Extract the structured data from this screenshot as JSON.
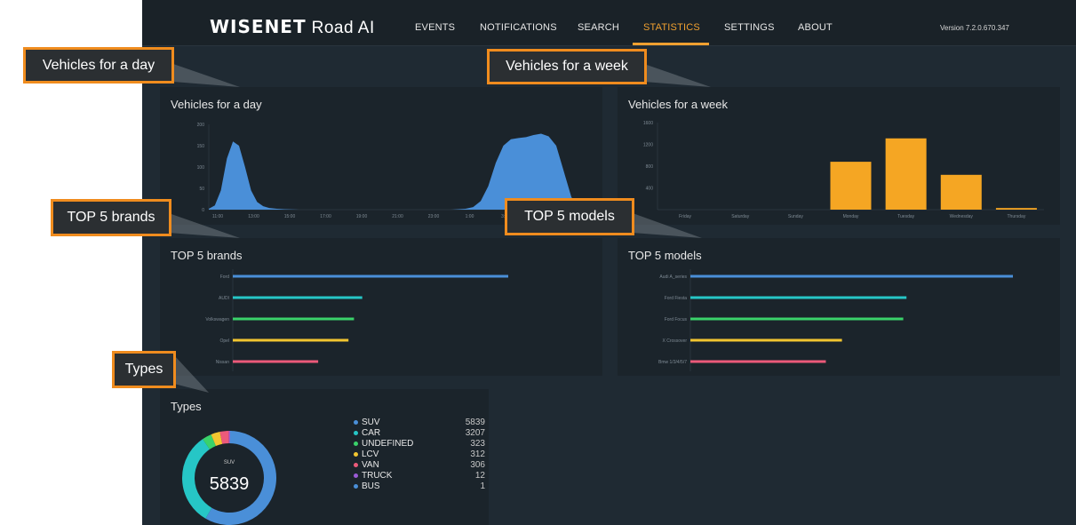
{
  "header": {
    "logo_brand": "WISENET",
    "logo_product": "Road AI",
    "nav": [
      {
        "label": "EVENTS",
        "active": false
      },
      {
        "label": "NOTIFICATIONS",
        "active": false
      },
      {
        "label": "SEARCH",
        "active": false
      },
      {
        "label": "STATISTICS",
        "active": true
      },
      {
        "label": "SETTINGS",
        "active": false
      },
      {
        "label": "ABOUT",
        "active": false
      }
    ],
    "version": "Version 7.2.0.670.347"
  },
  "callouts": {
    "day": "Vehicles for a day",
    "week": "Vehicles for a week",
    "brands": "TOP 5 brands",
    "models": "TOP 5 models",
    "types": "Types"
  },
  "colors": {
    "accent": "#f0a030",
    "area": "#4a8fd8",
    "bar_week": "#f5a623",
    "callout_border": "#f08c1e"
  },
  "chart_data": [
    {
      "type": "area",
      "title": "Vehicles for a day",
      "y_ticks": [
        "200",
        "150",
        "100",
        "50",
        "0"
      ],
      "x_ticks": [
        "11:00",
        "13:00",
        "15:00",
        "17:00",
        "19:00",
        "21:00",
        "23:00",
        "1:00",
        "3:00",
        "5:00",
        "7:00"
      ],
      "ylim": [
        0,
        200
      ],
      "x": [
        0,
        0.4,
        0.8,
        1.2,
        1.6,
        2.0,
        2.4,
        2.8,
        3.2,
        3.6,
        4.0,
        4.5,
        5.0,
        6,
        7,
        8,
        9,
        10,
        11,
        12,
        13,
        14,
        15,
        16,
        17,
        17.5,
        18,
        18.5,
        19,
        19.5,
        20,
        20.5,
        21,
        21.5,
        22,
        22.5,
        23,
        23.5,
        24,
        24.3,
        24.6,
        25
      ],
      "values": [
        2,
        10,
        45,
        120,
        160,
        150,
        100,
        45,
        18,
        8,
        4,
        2,
        1,
        0,
        0,
        0,
        0,
        0,
        0,
        0,
        0,
        0,
        0,
        0,
        2,
        6,
        20,
        55,
        110,
        150,
        165,
        168,
        170,
        175,
        178,
        172,
        150,
        90,
        30,
        10,
        4,
        2
      ]
    },
    {
      "type": "bar",
      "title": "Vehicles for a week",
      "y_ticks": [
        "1600",
        "1200",
        "800",
        "400"
      ],
      "categories": [
        "Friday",
        "Saturday",
        "Sunday",
        "Monday",
        "Tuesday",
        "Wednesday",
        "Thursday"
      ],
      "values": [
        0,
        0,
        0,
        880,
        1310,
        640,
        30
      ],
      "ylim": [
        0,
        1600
      ]
    },
    {
      "type": "bar",
      "orientation": "horizontal",
      "title": "TOP 5 brands",
      "categories": [
        "Ford",
        "AUDI",
        "Volkswagen",
        "Opel",
        "Nissan"
      ],
      "values": [
        100,
        47,
        44,
        42,
        31
      ],
      "colors": [
        "#4a8fd8",
        "#26c6c6",
        "#3ad26a",
        "#f2c530",
        "#ec5a7a"
      ]
    },
    {
      "type": "bar",
      "orientation": "horizontal",
      "title": "TOP 5 models",
      "categories": [
        "Audi A_series",
        "Ford Fiesta",
        "Ford Focus",
        "X Crossover",
        "Bmw 1/3/4/5/7"
      ],
      "values": [
        100,
        67,
        66,
        47,
        42
      ],
      "colors": [
        "#4a8fd8",
        "#26c6c6",
        "#3ad26a",
        "#f2c530",
        "#ec5a7a"
      ]
    },
    {
      "type": "pie",
      "title": "Types",
      "center_label": "SUV",
      "center_value": "5839",
      "categories": [
        "SUV",
        "CAR",
        "UNDEFINED",
        "LCV",
        "VAN",
        "TRUCK",
        "BUS"
      ],
      "values": [
        5839,
        3207,
        323,
        312,
        306,
        12,
        1
      ],
      "colors": [
        "#4a8fd8",
        "#26c6c6",
        "#3ad26a",
        "#f2c530",
        "#ec5a7a",
        "#9b5bd6",
        "#4a8fd8"
      ]
    }
  ]
}
